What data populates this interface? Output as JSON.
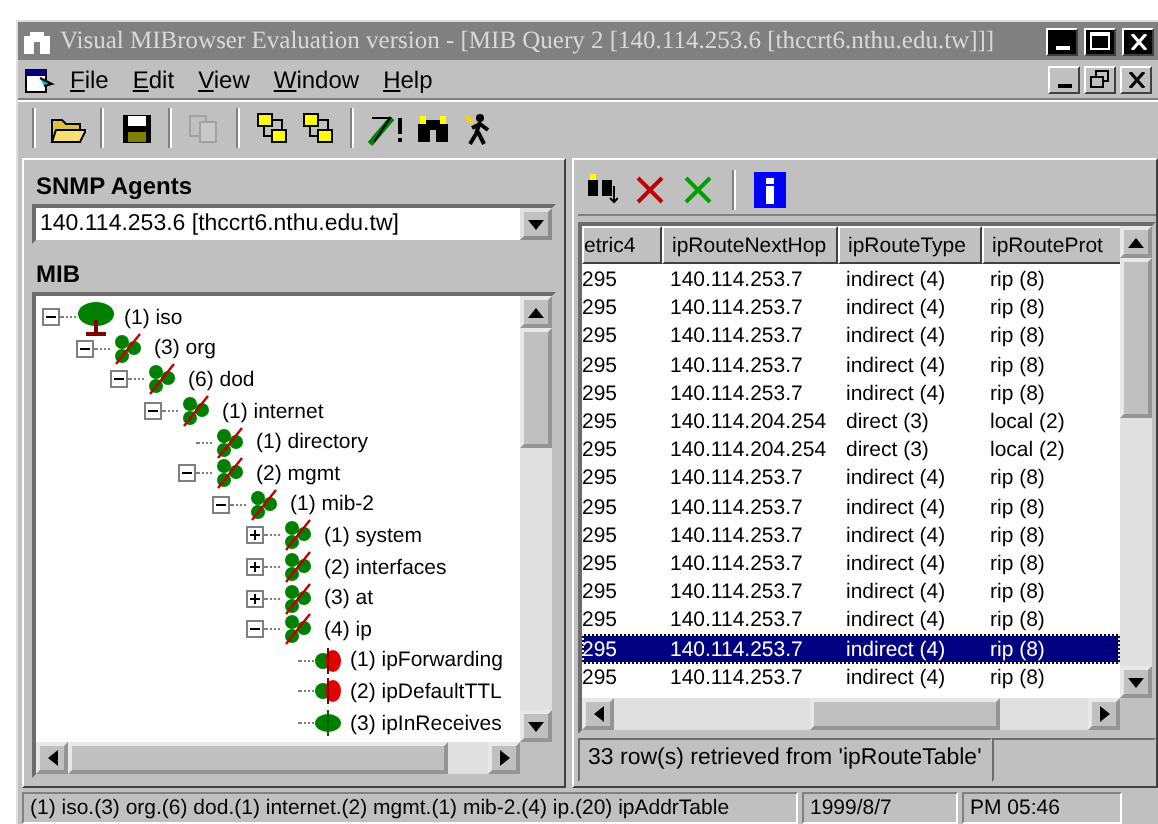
{
  "window": {
    "title": "Visual MIBrowser Evaluation version - [MIB Query 2 [140.114.253.6 [thccrt6.nthu.edu.tw]]]"
  },
  "menu": [
    "File",
    "Edit",
    "View",
    "Window",
    "Help"
  ],
  "toolbar": [
    {
      "kind": "open",
      "disabled": false
    },
    {
      "kind": "save",
      "disabled": false
    },
    {
      "kind": "copy",
      "disabled": true
    },
    {
      "kind": "link",
      "disabled": false
    },
    {
      "kind": "link",
      "disabled": false
    },
    {
      "kind": "wand",
      "disabled": false
    },
    {
      "kind": "find",
      "disabled": false
    },
    {
      "kind": "walker",
      "disabled": false
    }
  ],
  "agents": {
    "label": "SNMP Agents",
    "value": "140.114.253.6 [thccrt6.nthu.edu.tw]"
  },
  "mib": {
    "label": "MIB",
    "tree": [
      {
        "label": "(1) iso",
        "kind": "root",
        "expanded": true,
        "children": [
          {
            "label": "(3) org",
            "kind": "branch",
            "expanded": true,
            "children": [
              {
                "label": "(6) dod",
                "kind": "branch",
                "expanded": true,
                "children": [
                  {
                    "label": "(1) internet",
                    "kind": "branch",
                    "expanded": true,
                    "children": [
                      {
                        "label": "(1) directory",
                        "kind": "branch"
                      },
                      {
                        "label": "(2) mgmt",
                        "kind": "branch",
                        "expanded": true,
                        "children": [
                          {
                            "label": "(1) mib-2",
                            "kind": "branch",
                            "expanded": true,
                            "children": [
                              {
                                "label": "(1) system",
                                "kind": "branch",
                                "expanded": false
                              },
                              {
                                "label": "(2) interfaces",
                                "kind": "branch",
                                "expanded": false
                              },
                              {
                                "label": "(3) at",
                                "kind": "branch",
                                "expanded": false
                              },
                              {
                                "label": "(4) ip",
                                "kind": "branch",
                                "expanded": true,
                                "children": [
                                  {
                                    "label": "(1) ipForwarding",
                                    "kind": "writable"
                                  },
                                  {
                                    "label": "(2) ipDefaultTTL",
                                    "kind": "writable"
                                  },
                                  {
                                    "label": "(3) ipInReceives",
                                    "kind": "readonly"
                                  }
                                ]
                              }
                            ]
                          }
                        ]
                      }
                    ]
                  }
                ]
              }
            ]
          }
        ]
      }
    ]
  },
  "results": {
    "toolbar": [
      {
        "kind": "find"
      },
      {
        "kind": "delete"
      },
      {
        "kind": "cancel"
      },
      {
        "kind": "info"
      }
    ],
    "columns": [
      "etric4",
      "ipRouteNextHop",
      "ipRouteType",
      "ipRouteProt"
    ],
    "rows": [
      {
        "cells": [
          "295",
          "140.114.253.7",
          "indirect (4)",
          "rip (8)"
        ],
        "selected": false
      },
      {
        "cells": [
          "295",
          "140.114.253.7",
          "indirect (4)",
          "rip (8)"
        ],
        "selected": false
      },
      {
        "cells": [
          "295",
          "140.114.253.7",
          "indirect (4)",
          "rip (8)"
        ],
        "selected": false
      },
      {
        "cells": [
          "295",
          "140.114.253.7",
          "indirect (4)",
          "rip (8)"
        ],
        "selected": false
      },
      {
        "cells": [
          "295",
          "140.114.253.7",
          "indirect (4)",
          "rip (8)"
        ],
        "selected": false
      },
      {
        "cells": [
          "295",
          "140.114.204.254",
          "direct (3)",
          "local (2)"
        ],
        "selected": false
      },
      {
        "cells": [
          "295",
          "140.114.204.254",
          "direct (3)",
          "local (2)"
        ],
        "selected": false
      },
      {
        "cells": [
          "295",
          "140.114.253.7",
          "indirect (4)",
          "rip (8)"
        ],
        "selected": false
      },
      {
        "cells": [
          "295",
          "140.114.253.7",
          "indirect (4)",
          "rip (8)"
        ],
        "selected": false
      },
      {
        "cells": [
          "295",
          "140.114.253.7",
          "indirect (4)",
          "rip (8)"
        ],
        "selected": false
      },
      {
        "cells": [
          "295",
          "140.114.253.7",
          "indirect (4)",
          "rip (8)"
        ],
        "selected": false
      },
      {
        "cells": [
          "295",
          "140.114.253.7",
          "indirect (4)",
          "rip (8)"
        ],
        "selected": false
      },
      {
        "cells": [
          "295",
          "140.114.253.7",
          "indirect (4)",
          "rip (8)"
        ],
        "selected": false
      },
      {
        "cells": [
          "295",
          "140.114.253.7",
          "indirect (4)",
          "rip (8)"
        ],
        "selected": true
      },
      {
        "cells": [
          "295",
          "140.114.253.7",
          "indirect (4)",
          "rip (8)"
        ],
        "selected": false
      }
    ],
    "message": "33 row(s) retrieved from 'ipRouteTable'"
  },
  "status_bar": [
    "(1) iso.(3) org.(6) dod.(1) internet.(2) mgmt.(1) mib-2.(4) ip.(20) ipAddrTable",
    "1999/8/7",
    "PM 05:46"
  ]
}
